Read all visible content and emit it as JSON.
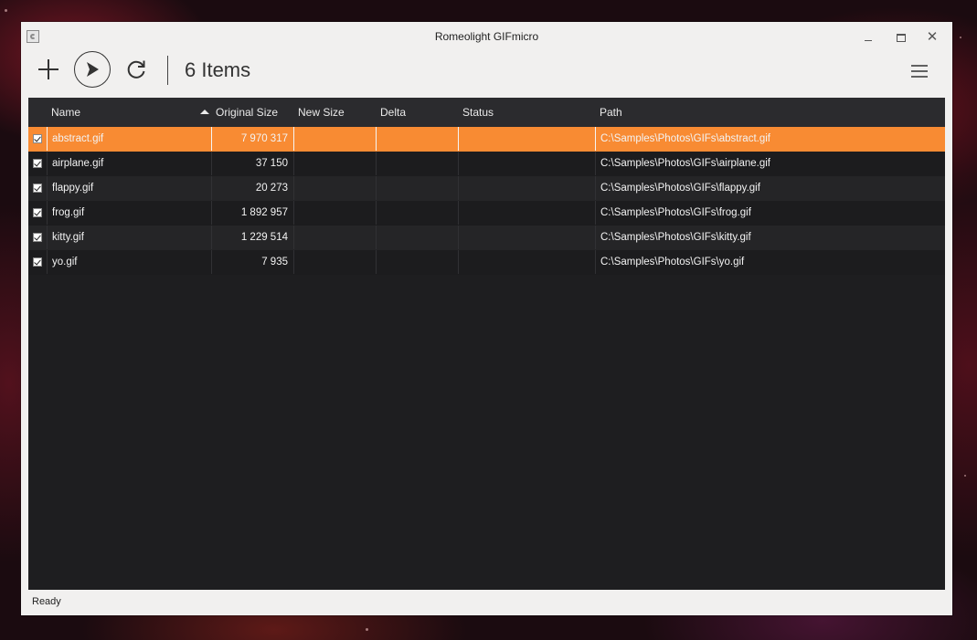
{
  "window": {
    "title": "Romeolight GIFmicro",
    "minimize_icon": "minimize-icon",
    "maximize_icon": "maximize-icon",
    "close_glyph": "✕"
  },
  "toolbar": {
    "add_icon": "plus-icon",
    "play_icon": "play-icon",
    "refresh_icon": "refresh-icon",
    "item_count": "6 Items",
    "menu_icon": "hamburger-menu-icon"
  },
  "table": {
    "columns": {
      "name": "Name",
      "original_size": "Original Size",
      "new_size": "New Size",
      "delta": "Delta",
      "status": "Status",
      "path": "Path"
    },
    "sort": {
      "column": "name",
      "direction": "ascending"
    },
    "rows": [
      {
        "checked": true,
        "name": "abstract.gif",
        "original_size": "7 970 317",
        "new_size": "",
        "delta": "",
        "status": "",
        "path": "C:\\Samples\\Photos\\GIFs\\abstract.gif",
        "selected": true
      },
      {
        "checked": true,
        "name": "airplane.gif",
        "original_size": "37 150",
        "new_size": "",
        "delta": "",
        "status": "",
        "path": "C:\\Samples\\Photos\\GIFs\\airplane.gif",
        "selected": false
      },
      {
        "checked": true,
        "name": "flappy.gif",
        "original_size": "20 273",
        "new_size": "",
        "delta": "",
        "status": "",
        "path": "C:\\Samples\\Photos\\GIFs\\flappy.gif",
        "selected": false
      },
      {
        "checked": true,
        "name": "frog.gif",
        "original_size": "1 892 957",
        "new_size": "",
        "delta": "",
        "status": "",
        "path": "C:\\Samples\\Photos\\GIFs\\frog.gif",
        "selected": false
      },
      {
        "checked": true,
        "name": "kitty.gif",
        "original_size": "1 229 514",
        "new_size": "",
        "delta": "",
        "status": "",
        "path": "C:\\Samples\\Photos\\GIFs\\kitty.gif",
        "selected": false
      },
      {
        "checked": true,
        "name": "yo.gif",
        "original_size": "7 935",
        "new_size": "",
        "delta": "",
        "status": "",
        "path": "C:\\Samples\\Photos\\GIFs\\yo.gif",
        "selected": false
      }
    ]
  },
  "statusbar": {
    "text": "Ready"
  },
  "colors": {
    "selection": "#f88b33",
    "grid_background": "#1e1e20",
    "header_background": "#2b2b2e",
    "window_background": "#f1f0ef"
  }
}
